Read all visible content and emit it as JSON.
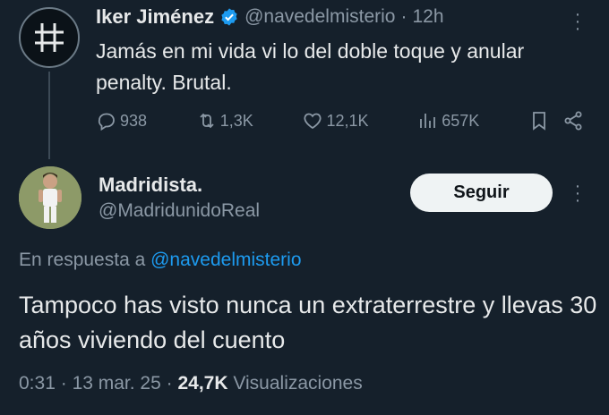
{
  "parent_tweet": {
    "author_name": "Iker Jiménez",
    "handle": "@navedelmisterio",
    "separator": "·",
    "time": "12h",
    "text": "Jamás en mi vida vi lo del doble toque y anular penalty. Brutal.",
    "stats": {
      "replies": "938",
      "retweets": "1,3K",
      "likes": "12,1K",
      "views": "657K"
    },
    "avatar_icon": "hashtag-grid-icon"
  },
  "reply_tweet": {
    "author_name": "Madridista.",
    "handle": "@MadridunidoReal",
    "follow_label": "Seguir",
    "in_reply_prefix": "En respuesta a",
    "in_reply_handle": "@navedelmisterio",
    "text": "Tampoco has visto nunca un extraterrestre y llevas 30 años viviendo del cuento",
    "time": "0:31",
    "date": "13 mar. 25",
    "separator": "·",
    "views_count": "24,7K",
    "views_label": "Visualizaciones"
  },
  "colors": {
    "background": "#15202b",
    "text": "#e7e9ea",
    "muted": "#8b98a5",
    "link": "#1d9bf0",
    "verified": "#1d9bf0"
  }
}
